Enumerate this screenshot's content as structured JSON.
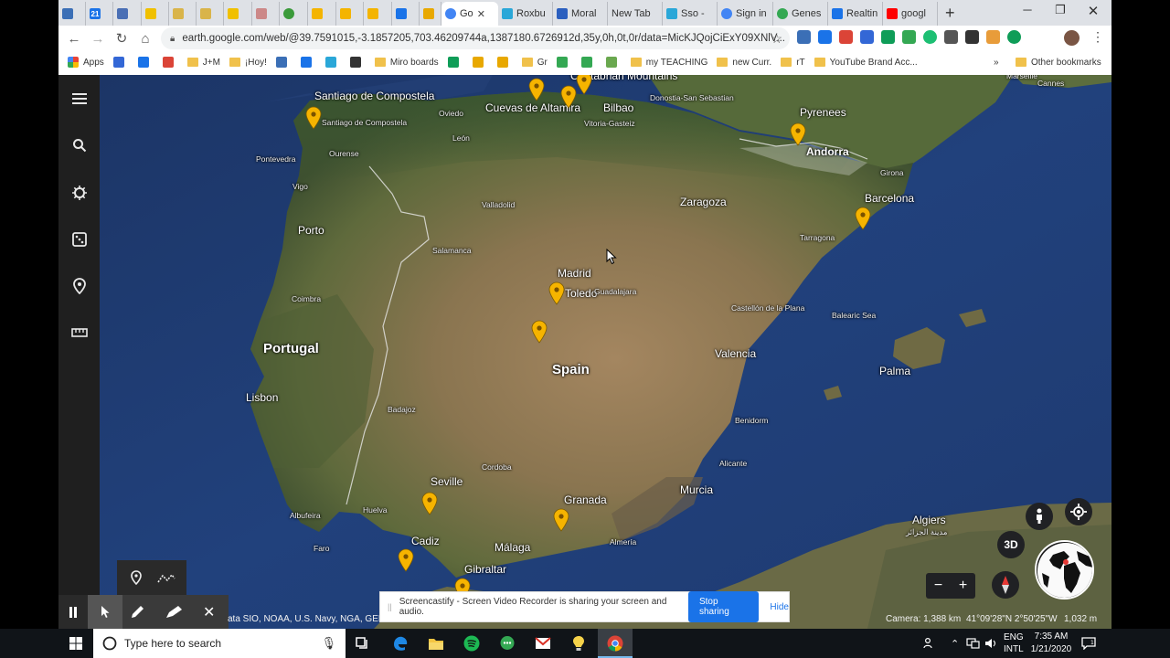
{
  "browser": {
    "tabs": [
      {
        "label": "",
        "favicon": "V-icon",
        "color": "#3b6fb6"
      },
      {
        "label": "",
        "favicon": "calendar-icon",
        "color": "#1a73e8",
        "text": "21"
      },
      {
        "label": "",
        "favicon": "shield-icon",
        "color": "#4a6fb5"
      },
      {
        "label": "",
        "favicon": "m-icon",
        "color": "#f0c000"
      },
      {
        "label": "",
        "favicon": "m-icon",
        "color": "#d9b44a"
      },
      {
        "label": "",
        "favicon": "m-icon",
        "color": "#d9b44a"
      },
      {
        "label": "",
        "favicon": "m-icon",
        "color": "#f0c000"
      },
      {
        "label": "",
        "favicon": "image-icon",
        "color": "#c88"
      },
      {
        "label": "",
        "favicon": "gear-icon",
        "color": "#3a9a3a"
      },
      {
        "label": "",
        "favicon": "slides-icon",
        "color": "#f4b400"
      },
      {
        "label": "",
        "favicon": "slides-icon",
        "color": "#f4b400"
      },
      {
        "label": "",
        "favicon": "slides-icon",
        "color": "#f4b400"
      },
      {
        "label": "",
        "favicon": "swirl-icon",
        "color": "#1a73e8"
      },
      {
        "label": "",
        "favicon": "c-icon",
        "color": "#e8a800"
      },
      {
        "label": "Go",
        "favicon": "google-earth-icon",
        "color": "#4285f4",
        "active": true
      },
      {
        "label": "Roxbu",
        "favicon": "seesaw-icon",
        "color": "#2aa7d8"
      },
      {
        "label": "Moral",
        "favicon": "person-icon",
        "color": "#2b5fbf"
      },
      {
        "label": "New Tab",
        "favicon": "",
        "color": ""
      },
      {
        "label": "Sso -",
        "favicon": "seesaw-icon",
        "color": "#2aa7d8"
      },
      {
        "label": "Sign in",
        "favicon": "google-icon",
        "color": "#4285f4"
      },
      {
        "label": "Genes",
        "favicon": "globe-icon",
        "color": "#34a853"
      },
      {
        "label": "Realtin",
        "favicon": "wave-icon",
        "color": "#1a73e8"
      },
      {
        "label": "googl",
        "favicon": "youtube-icon",
        "color": "#ff0000"
      }
    ],
    "url": "earth.google.com/web/@39.7591015,-3.1857205,703.46209744a,1387180.6726912d,35y,0h,0t,0r/data=MicKJQojCiExY09XNlV...",
    "bookmarks": [
      {
        "label": "Apps",
        "type": "apps",
        "color": "#4285f4"
      },
      {
        "label": "",
        "type": "icon",
        "color": "#3367d6"
      },
      {
        "label": "",
        "type": "icon",
        "color": "#1a73e8"
      },
      {
        "label": "",
        "type": "icon",
        "color": "#db4437"
      },
      {
        "label": "J+M",
        "type": "folder",
        "color": "#f0c14b"
      },
      {
        "label": "¡Hoy!",
        "type": "folder",
        "color": "#f0c14b"
      },
      {
        "label": "",
        "type": "icon",
        "color": "#3b6fb6"
      },
      {
        "label": "",
        "type": "icon",
        "color": "#1a73e8"
      },
      {
        "label": "",
        "type": "icon",
        "color": "#2aa7d8"
      },
      {
        "label": "",
        "type": "icon",
        "color": "#333"
      },
      {
        "label": "Miro boards",
        "type": "folder",
        "color": "#f0c14b"
      },
      {
        "label": "",
        "type": "icon",
        "color": "#0f9d58"
      },
      {
        "label": "",
        "type": "icon",
        "color": "#e8a800"
      },
      {
        "label": "",
        "type": "icon",
        "color": "#e8a800"
      },
      {
        "label": "Gr",
        "type": "folder",
        "color": "#f0c14b"
      },
      {
        "label": "",
        "type": "icon",
        "color": "#34a853"
      },
      {
        "label": "",
        "type": "icon",
        "color": "#34a853"
      },
      {
        "label": "",
        "type": "icon",
        "color": "#6aa84f"
      },
      {
        "label": "my TEACHING",
        "type": "folder",
        "color": "#f0c14b"
      },
      {
        "label": "new Curr.",
        "type": "folder",
        "color": "#f0c14b"
      },
      {
        "label": "rT",
        "type": "folder",
        "color": "#f0c14b"
      },
      {
        "label": "YouTube Brand Acc...",
        "type": "folder",
        "color": "#f0c14b"
      },
      {
        "label": "»",
        "type": "more",
        "color": ""
      },
      {
        "label": "Other bookmarks",
        "type": "folder",
        "color": "#f0c14b"
      }
    ]
  },
  "map": {
    "places": [
      {
        "name": "Cantabrian Mountains",
        "size": "normal"
      },
      {
        "name": "Santiago de Compostela",
        "size": "normal"
      },
      {
        "name": "Cuevas de Altamira",
        "size": "normal"
      },
      {
        "name": "Bilbao",
        "size": "normal"
      },
      {
        "name": "Donostia-San Sebastian",
        "size": "small"
      },
      {
        "name": "Pyrenees",
        "size": "normal"
      },
      {
        "name": "Andorra",
        "size": "bold"
      },
      {
        "name": "Oviedo",
        "size": "small"
      },
      {
        "name": "Vitoria-Gasteiz",
        "size": "small"
      },
      {
        "name": "León",
        "size": "small"
      },
      {
        "name": "Santiago de Compostela",
        "size": "small"
      },
      {
        "name": "Pontevedra",
        "size": "small"
      },
      {
        "name": "Ourense",
        "size": "small"
      },
      {
        "name": "Vigo",
        "size": "small"
      },
      {
        "name": "Zaragoza",
        "size": "normal"
      },
      {
        "name": "Girona",
        "size": "small"
      },
      {
        "name": "Barcelona",
        "size": "normal"
      },
      {
        "name": "Valladolid",
        "size": "small"
      },
      {
        "name": "Porto",
        "size": "normal"
      },
      {
        "name": "Tarragona",
        "size": "small"
      },
      {
        "name": "Salamanca",
        "size": "small"
      },
      {
        "name": "Madrid",
        "size": "normal"
      },
      {
        "name": "Toledo",
        "size": "normal"
      },
      {
        "name": "Coimbra",
        "size": "small"
      },
      {
        "name": "Castellón de la Plana",
        "size": "small"
      },
      {
        "name": "Balearic Sea",
        "size": "small"
      },
      {
        "name": "Portugal",
        "size": "country"
      },
      {
        "name": "Valencia",
        "size": "normal"
      },
      {
        "name": "Spain",
        "size": "country"
      },
      {
        "name": "Palma",
        "size": "normal"
      },
      {
        "name": "Lisbon",
        "size": "normal"
      },
      {
        "name": "Badajoz",
        "size": "small"
      },
      {
        "name": "Benidorm",
        "size": "small"
      },
      {
        "name": "Cordoba",
        "size": "small"
      },
      {
        "name": "Alicante",
        "size": "small"
      },
      {
        "name": "Seville",
        "size": "normal"
      },
      {
        "name": "Murcia",
        "size": "normal"
      },
      {
        "name": "Granada",
        "size": "normal"
      },
      {
        "name": "Huelva",
        "size": "small"
      },
      {
        "name": "Albufeira",
        "size": "small"
      },
      {
        "name": "Algiers",
        "size": "normal"
      },
      {
        "name": "مدينة الجزائر",
        "size": "small"
      },
      {
        "name": "Cadiz",
        "size": "normal"
      },
      {
        "name": "Faro",
        "size": "small"
      },
      {
        "name": "Málaga",
        "size": "normal"
      },
      {
        "name": "Almería",
        "size": "small"
      },
      {
        "name": "Gibraltar",
        "size": "normal"
      },
      {
        "name": "Marseille",
        "size": "small"
      },
      {
        "name": "Cannes",
        "size": "small"
      },
      {
        "name": "Guadalajara",
        "size": "small"
      }
    ],
    "pin_count": 12,
    "pin_color": "#f6b400",
    "attribution": "ata SIO, NOAA, U.S. Navy, NGA, GEBC",
    "camera": "Camera: 1,388 km",
    "coordinates": "41°09'28\"N 2°50'25\"W",
    "elevation": "1,032 m",
    "button_3d": "3D"
  },
  "screencastify": {
    "message": "Screencastify - Screen Video Recorder is sharing your screen and audio.",
    "stop_label": "Stop sharing",
    "hide_label": "Hide"
  },
  "taskbar": {
    "search_placeholder": "Type here to search",
    "lang_line1": "ENG",
    "lang_line2": "INTL",
    "time": "7:35 AM",
    "date": "1/21/2020"
  }
}
